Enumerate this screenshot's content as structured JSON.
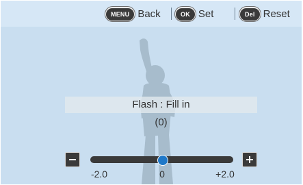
{
  "topbar": {
    "back": {
      "button": "MENU",
      "label": "Back"
    },
    "set": {
      "button": "OK",
      "label": "Set"
    },
    "reset": {
      "button": "Del",
      "label": "Reset"
    }
  },
  "flash": {
    "mode_label": "Flash : Fill in",
    "value_text": "(0)",
    "value": 0
  },
  "slider": {
    "min_label": "-2.0",
    "mid_label": "0",
    "max_label": "+2.0",
    "min": -2.0,
    "max": 2.0,
    "value": 0,
    "accent_color": "#1f78c8"
  },
  "icons": {
    "decrease": "minus-icon",
    "increase": "plus-icon"
  }
}
